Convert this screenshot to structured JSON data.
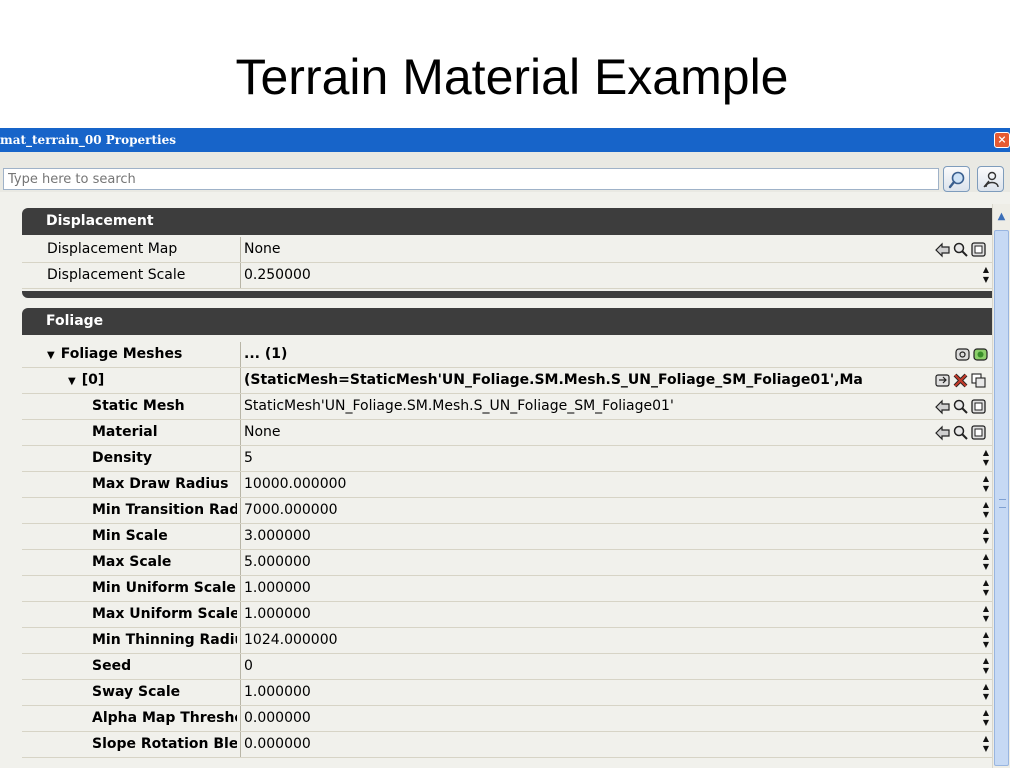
{
  "slide": {
    "title": "Terrain Material Example"
  },
  "window": {
    "title": "mat_terrain_00 Properties",
    "close_label": "×"
  },
  "search": {
    "placeholder": "Type here to search",
    "value": ""
  },
  "categories": {
    "displacement": "Displacement",
    "foliage": "Foliage"
  },
  "displacement_rows": [
    {
      "name": "Displacement Map",
      "value": "None"
    },
    {
      "name": "Displacement Scale",
      "value": "0.250000"
    }
  ],
  "foliage": {
    "meshes_name": "Foliage Meshes",
    "meshes_value": "... (1)",
    "item_name": "[0]",
    "item_value": "(StaticMesh=StaticMesh'UN_Foliage.SM.Mesh.S_UN_Foliage_SM_Foliage01',Ma",
    "props": [
      {
        "name": "Static Mesh",
        "value": "StaticMesh'UN_Foliage.SM.Mesh.S_UN_Foliage_SM_Foliage01'"
      },
      {
        "name": "Material",
        "value": "None"
      },
      {
        "name": "Density",
        "value": "5"
      },
      {
        "name": "Max Draw Radius",
        "value": "10000.000000"
      },
      {
        "name": "Min Transition Radius",
        "value": "7000.000000"
      },
      {
        "name": "Min Scale",
        "value": "3.000000"
      },
      {
        "name": "Max Scale",
        "value": "5.000000"
      },
      {
        "name": "Min Uniform Scale",
        "value": "1.000000"
      },
      {
        "name": "Max Uniform Scale",
        "value": "1.000000"
      },
      {
        "name": "Min Thinning Radius",
        "value": "1024.000000"
      },
      {
        "name": "Seed",
        "value": "0"
      },
      {
        "name": "Sway Scale",
        "value": "1.000000"
      },
      {
        "name": "Alpha Map Threshold",
        "value": "0.000000"
      },
      {
        "name": "Slope Rotation Blend",
        "value": "0.000000"
      }
    ]
  },
  "icons": {
    "find": "find-in-browser-icon",
    "use": "use-selected-icon",
    "clear": "clear-icon",
    "spinner": "spinner-arrows-icon"
  },
  "colors": {
    "titlebar": "#1764c9",
    "category": "#3d3d3d",
    "panel": "#f1f1ec"
  }
}
